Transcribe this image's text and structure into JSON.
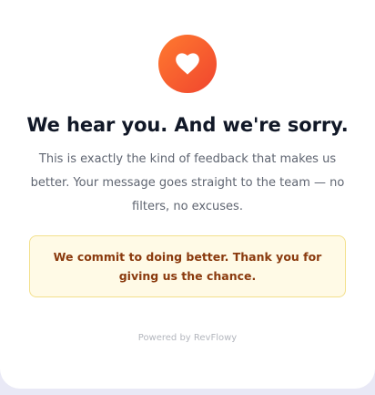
{
  "feedback": {
    "icon": "heart-icon",
    "accent_color": "#f25c2c",
    "title": "We hear you. And we're sorry.",
    "message": "This is exactly the kind of feedback that makes us better. Your message goes straight to the team — no filters, no excuses.",
    "commitment": "We commit to doing better. Thank you for giving us the chance.",
    "powered_by": "Powered by RevFlowy"
  }
}
